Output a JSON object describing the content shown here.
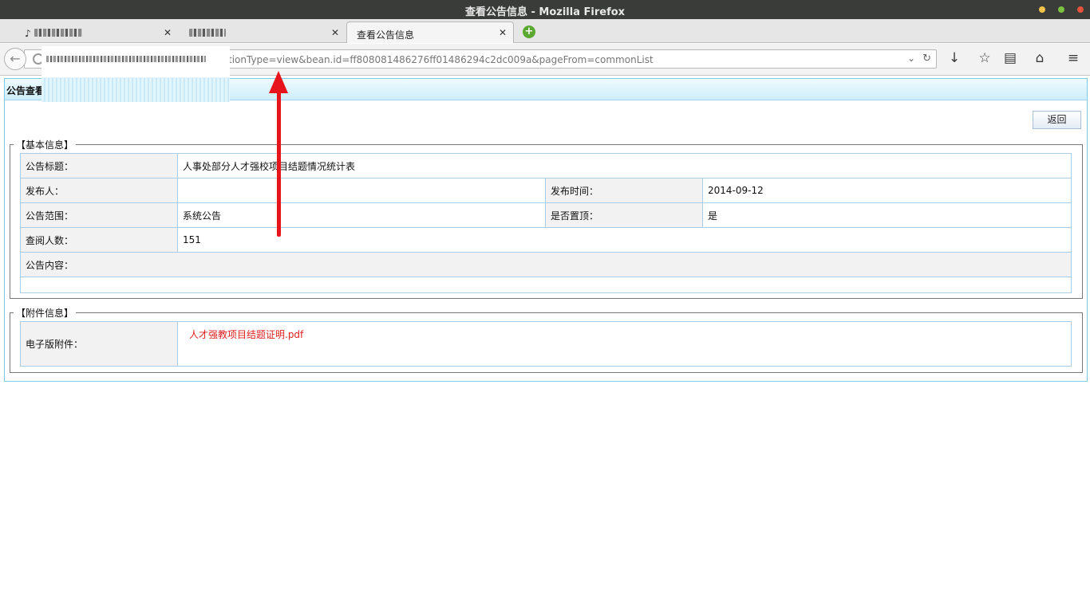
{
  "window": {
    "title": "查看公告信息 - Mozilla Firefox"
  },
  "tabs": [
    {
      "label": "",
      "active": false
    },
    {
      "label": "",
      "active": false
    },
    {
      "label": "查看公告信息",
      "active": true
    }
  ],
  "tab_close_glyph": "✕",
  "navbar": {
    "url_visible": "tionType=view&bean.id=ff808081486276ff01486294c2dc009a&pageFrom=commonList",
    "icons": [
      "back-arrow-icon",
      "globe-icon",
      "dropdown-icon",
      "reload-icon",
      "download-icon",
      "bookmark-star-icon",
      "reading-list-icon",
      "home-icon",
      "menu-icon"
    ]
  },
  "page": {
    "header_title": "公告查看",
    "back_button": "返回",
    "basic_info": {
      "legend": "【基本信息】",
      "title_label": "公告标题：",
      "title_value": "人事处部分人才强校项目结题情况统计表",
      "publisher_label": "发布人：",
      "publisher_value": "",
      "publish_time_label": "发布时间：",
      "publish_time_value": "2014-09-12",
      "scope_label": "公告范围：",
      "scope_value": "系统公告",
      "pinned_label": "是否置顶：",
      "pinned_value": "是",
      "views_label": "查阅人数：",
      "views_value": "151",
      "content_label": "公告内容：",
      "content_value": ""
    },
    "attachment_info": {
      "legend": "【附件信息】",
      "label": "电子版附件：",
      "file": "人才强教项目结题证明.pdf"
    }
  },
  "colors": {
    "annotation_arrow": "#e8141c",
    "attachment_link": "#e02020",
    "header_gradient_bottom": "#cdeefb"
  }
}
